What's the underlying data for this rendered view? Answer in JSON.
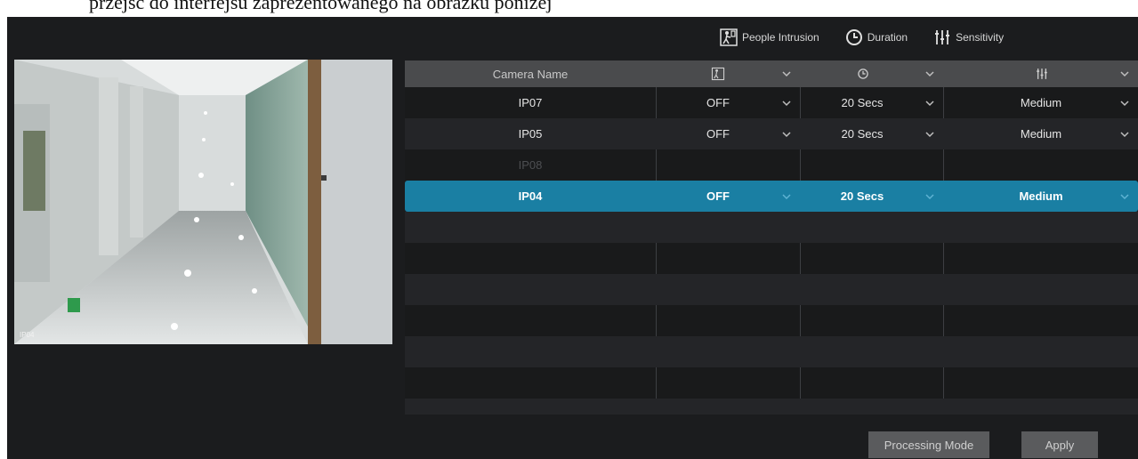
{
  "document": {
    "caption_fragment": "przejść do interfejsu zaprezentowanego na obrazku poniżej"
  },
  "legend": {
    "people_intrusion": "People Intrusion",
    "duration": "Duration",
    "sensitivity": "Sensitivity"
  },
  "preview": {
    "camera_label": "IP04"
  },
  "table": {
    "headers": {
      "camera_name": "Camera Name"
    },
    "rows": [
      {
        "camera": "IP07",
        "intrusion": "OFF",
        "duration": "20 Secs",
        "sensitivity": "Medium"
      },
      {
        "camera": "IP05",
        "intrusion": "OFF",
        "duration": "20 Secs",
        "sensitivity": "Medium"
      },
      {
        "camera": "IP08",
        "intrusion": "",
        "duration": "",
        "sensitivity": ""
      },
      {
        "camera": "IP04",
        "intrusion": "OFF",
        "duration": "20 Secs",
        "sensitivity": "Medium"
      }
    ],
    "selected_row_index": 3
  },
  "buttons": {
    "processing_mode": "Processing Mode",
    "apply": "Apply"
  },
  "colors": {
    "background": "#1b1c1e",
    "header": "#4a4b4d",
    "selected": "#1a7fa3",
    "button": "#5a5b5d"
  },
  "icons": [
    "people-intrusion-icon",
    "clock-icon",
    "sliders-icon",
    "chevron-down-icon"
  ]
}
